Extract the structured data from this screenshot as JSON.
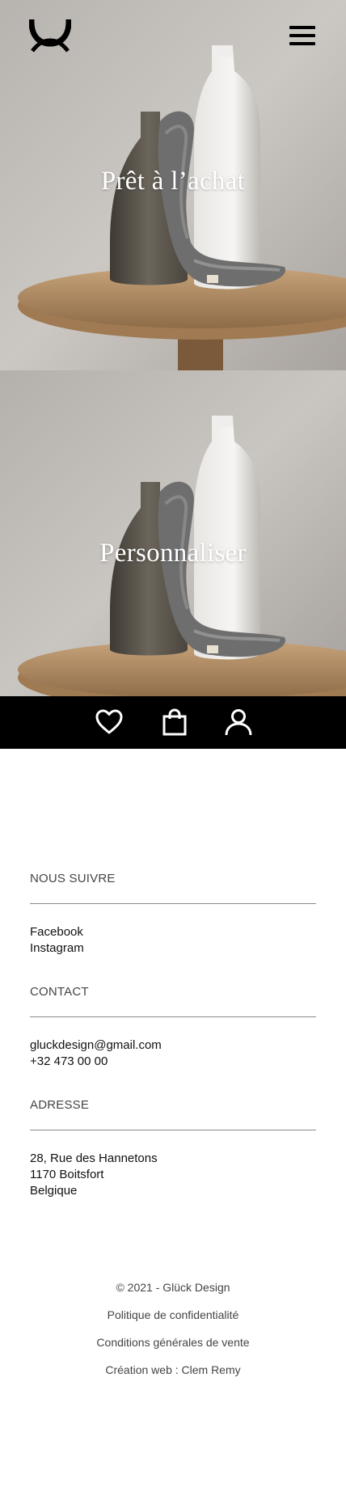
{
  "header": {
    "logo_icon": "glueck-logo-icon",
    "menu_icon": "hamburger-menu-icon"
  },
  "hero_sections": [
    {
      "title": "Prêt à l’achat"
    },
    {
      "title": "Personnaliser"
    }
  ],
  "icon_bar": {
    "items": [
      {
        "icon": "heart-icon"
      },
      {
        "icon": "shopping-bag-icon"
      },
      {
        "icon": "user-icon"
      }
    ]
  },
  "footer": {
    "follow": {
      "title": "NOUS SUIVRE",
      "links": [
        "Facebook",
        "Instagram"
      ]
    },
    "contact": {
      "title": "CONTACT",
      "email": "gluckdesign@gmail.com",
      "phone": "+32 473 00 00"
    },
    "address": {
      "title": "ADRESSE",
      "lines": [
        "28, Rue des Hannetons",
        "1170 Boitsfort",
        "Belgique"
      ]
    },
    "bottom": {
      "copyright": "© 2021 - Glück Design",
      "privacy": "Politique de confidentialité",
      "terms": "Conditions générales de vente",
      "credit": "Création web : Clem Remy"
    }
  }
}
